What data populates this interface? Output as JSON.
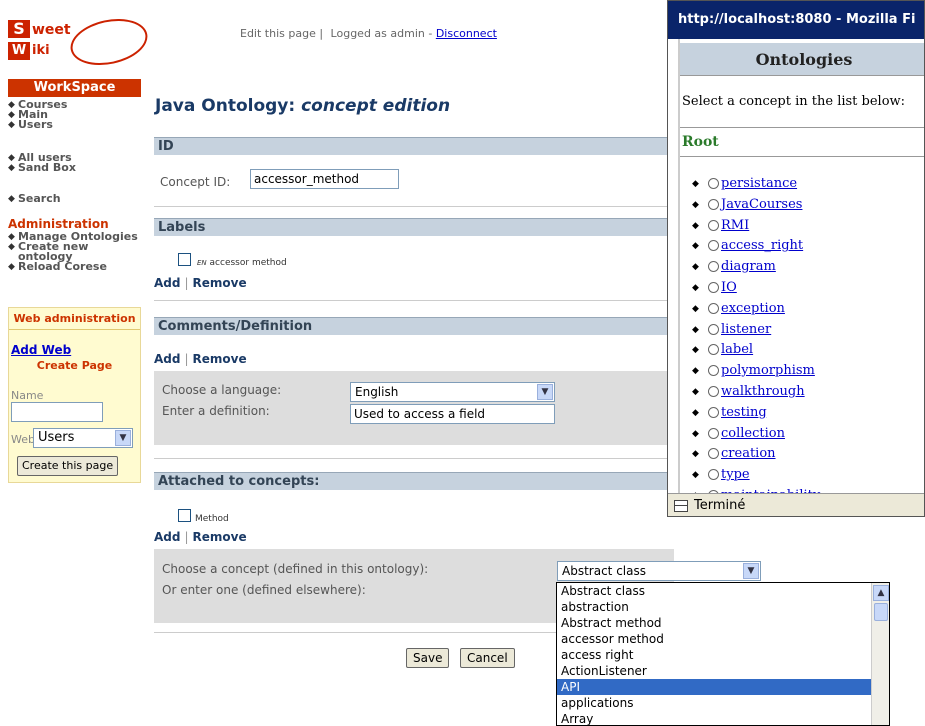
{
  "logo": {
    "s_letter": "S",
    "weet": "weet",
    "w_letter": "W",
    "iki": "iki"
  },
  "topbar": {
    "edit": "Edit this page |",
    "logged": "Logged as admin -",
    "disconnect": "Disconnect"
  },
  "sidebar": {
    "workspace": "WorkSpace",
    "group1": [
      "Courses",
      "Main",
      "Users"
    ],
    "group2": [
      "All users",
      "Sand Box"
    ],
    "group3": [
      "Search"
    ],
    "admin_title": "Administration",
    "admin_items": [
      "Manage Ontologies",
      "Create new ontology",
      "Reload Corese"
    ],
    "box": {
      "web_admin": "Web administration",
      "add_web": "Add Web",
      "create_page": "Create Page",
      "name_label": "Name",
      "web_label": "Web",
      "web_value": "Users",
      "create_button": "Create this page"
    }
  },
  "main": {
    "title": "Java Ontology:",
    "title_sub": "concept edition",
    "id_section": "ID",
    "concept_id_label": "Concept ID:",
    "concept_id_value": "accessor_method",
    "labels_section": "Labels",
    "label_lang": "EN",
    "label_text": "accessor method",
    "add": "Add",
    "remove": "Remove",
    "comments_section": "Comments/Definition",
    "choose_language_label": "Choose a language:",
    "language_value": "English",
    "enter_definition_label": "Enter a definition:",
    "definition_value": "Used to access a field",
    "attached_section": "Attached to concepts:",
    "attached_item": "Method",
    "choose_concept_label": "Choose a concept (defined in this ontology):",
    "concept_select_value": "Abstract class",
    "enter_one_label": "Or enter one (defined elsewhere):",
    "save": "Save",
    "cancel": "Cancel"
  },
  "dropdown": {
    "options": [
      "Abstract class",
      "abstraction",
      "Abstract method",
      "accessor method",
      "access right",
      "ActionListener",
      "API",
      "applications",
      "Array"
    ],
    "selected_index": 6
  },
  "popup": {
    "title": "http://localhost:8080 - Mozilla Fi",
    "heading": "Ontologies",
    "prompt": "Select a concept in the list below:",
    "root": "Root",
    "items": [
      "persistance",
      "JavaCourses",
      "RMI",
      "access_right",
      "diagram",
      "IO",
      "exception",
      "listener",
      "label",
      "polymorphism",
      "walkthrough",
      "testing",
      "collection",
      "creation",
      "type",
      "maintainability"
    ],
    "status": "Terminé"
  },
  "colors": {
    "accent": "#cc3300",
    "section_header": "#c6d2de",
    "title_blue": "#1a3a66",
    "selected": "#316ac5"
  }
}
